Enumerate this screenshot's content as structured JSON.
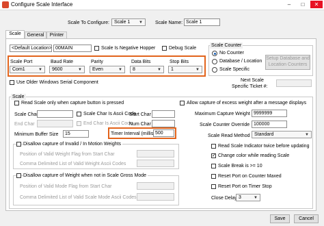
{
  "window": {
    "title": "Configure Scale Interface",
    "minimize_glyph": "–",
    "maximize_glyph": "□",
    "close_glyph": "✕"
  },
  "header": {
    "scale_to_configure_label": "Scale To Configure:",
    "scale_to_configure_value": "Scale 1",
    "scale_name_label": "Scale Name:",
    "scale_name_value": "Scale 1"
  },
  "tabs": [
    "Scale",
    "General",
    "Printer"
  ],
  "location": {
    "default_location_label": "<Default Location>",
    "location_code": "00MAIN",
    "negative_hopper_label": "Scale Is Negative Hopper",
    "debug_scale_label": "Debug Scale"
  },
  "port_settings": {
    "scale_port_label": "Scale Port",
    "scale_port_value": "Com1",
    "baud_rate_label": "Baud Rate",
    "baud_rate_value": "9600",
    "parity_label": "Parity",
    "parity_value": "Even",
    "data_bits_label": "Data Bits",
    "data_bits_value": "8",
    "stop_bits_label": "Stop Bits",
    "stop_bits_value": "1",
    "use_older_windows_label": "Use Older Windows Serial Component"
  },
  "scale_counter": {
    "title": "Scale Counter",
    "options": [
      "No Counter",
      "Database / Location",
      "Scale Specific"
    ],
    "selected": "No Counter",
    "setup_button_line1": "Setup Database and",
    "setup_button_line2": "Location Counters",
    "next_ticket_label_line1": "Next Scale",
    "next_ticket_label_line2": "Specific Ticket #:"
  },
  "scale_group": {
    "title": "Scale",
    "read_scale_label": "Read Scale only when capture button is pressed",
    "scale_char_label": "Scale Char",
    "scale_char_ascii_label": "Scale Char Is Ascii Code",
    "end_char_label": "End Char",
    "end_char_ascii_label": "End Char Is Ascii Code",
    "start_char_label": "Start Char",
    "num_char_label": "Num Char",
    "min_buffer_label": "Minimum Buffer Size",
    "min_buffer_value": "15",
    "timer_interval_label": "Timer Interval (milliseconds)",
    "timer_interval_value": "500",
    "disallow_motion_label": "Disallow capture of Invalid / In Motion Weights",
    "motion_position_label": "Position of Valid Weight Flag from Start Char",
    "motion_comma_label": "Comma Delimited List of Valid Weight Ascii Codes",
    "disallow_gross_label": "Disallow capture of Weight when not in Scale Gross Mode",
    "gross_position_label": "Position of Valid Mode Flag from Start Char",
    "gross_comma_label": "Comma Delimited List of Valid Scale Mode Ascii Codes"
  },
  "right_settings": {
    "allow_excess_label": "Allow capture of excess weight after a message displays",
    "max_capture_label": "Maximum Capture Weight",
    "max_capture_value": "9999999",
    "counter_override_label": "Scale Counter Override",
    "counter_override_value": "100000",
    "read_method_label": "Scale Read Method",
    "read_method_value": "Standard",
    "read_twice_label": "Read Scale Indicator twice before updating",
    "change_color_label": "Change color while reading Scale",
    "change_color_checked": true,
    "scale_break_label": "Scale Break is >= 10",
    "reset_port_label": "Reset Port on Counter Maxed",
    "reset_timer_label": "Reset Port on Timer Stop",
    "close_delay_label": "Close Delay",
    "close_delay_value": "3"
  },
  "footer": {
    "save_label": "Save",
    "cancel_label": "Cancel"
  },
  "colors": {
    "highlight": "#e2631b",
    "titlebar_close": "#e81123",
    "radio_selected": "#1a5fb4"
  }
}
